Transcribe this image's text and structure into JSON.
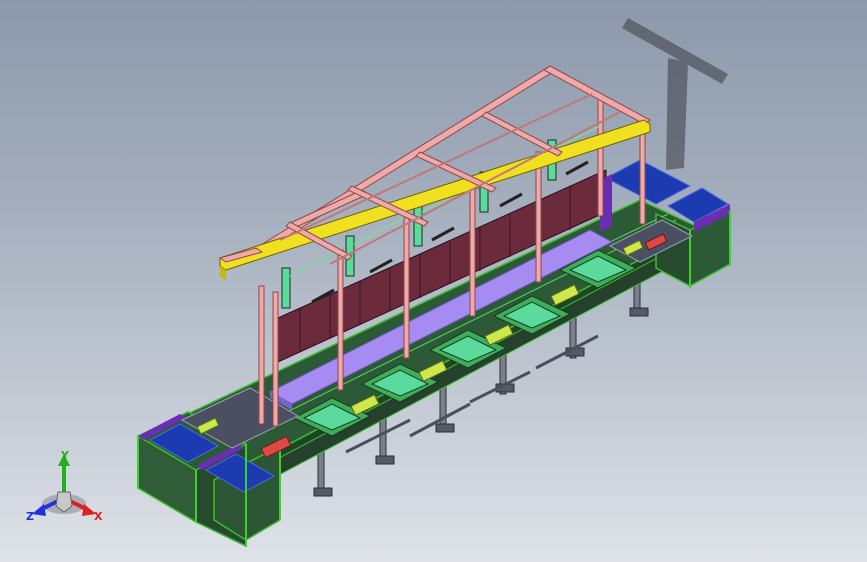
{
  "triad": {
    "x_label": "X",
    "y_label": "Y",
    "z_label": "Z",
    "colors": {
      "x": "#e02020",
      "y": "#20b020",
      "z": "#2030e0"
    }
  },
  "colors": {
    "background_top": "#8d99ab",
    "background_bottom": "#dfe3e9",
    "canopy_frame": "#f0a8a8",
    "canopy_front_beam": "#f0e020",
    "frame_green": "#39c02a",
    "conveyor_deck": "#2d5a36",
    "end_tray_blue": "#1d3bb0",
    "end_tray_purple": "#6a2fb0",
    "curtain": "#6b2b3d",
    "light_panel": "#a68cf0",
    "fixture_green": "#5adb9b",
    "legs_gray": "#3a3f4a"
  }
}
